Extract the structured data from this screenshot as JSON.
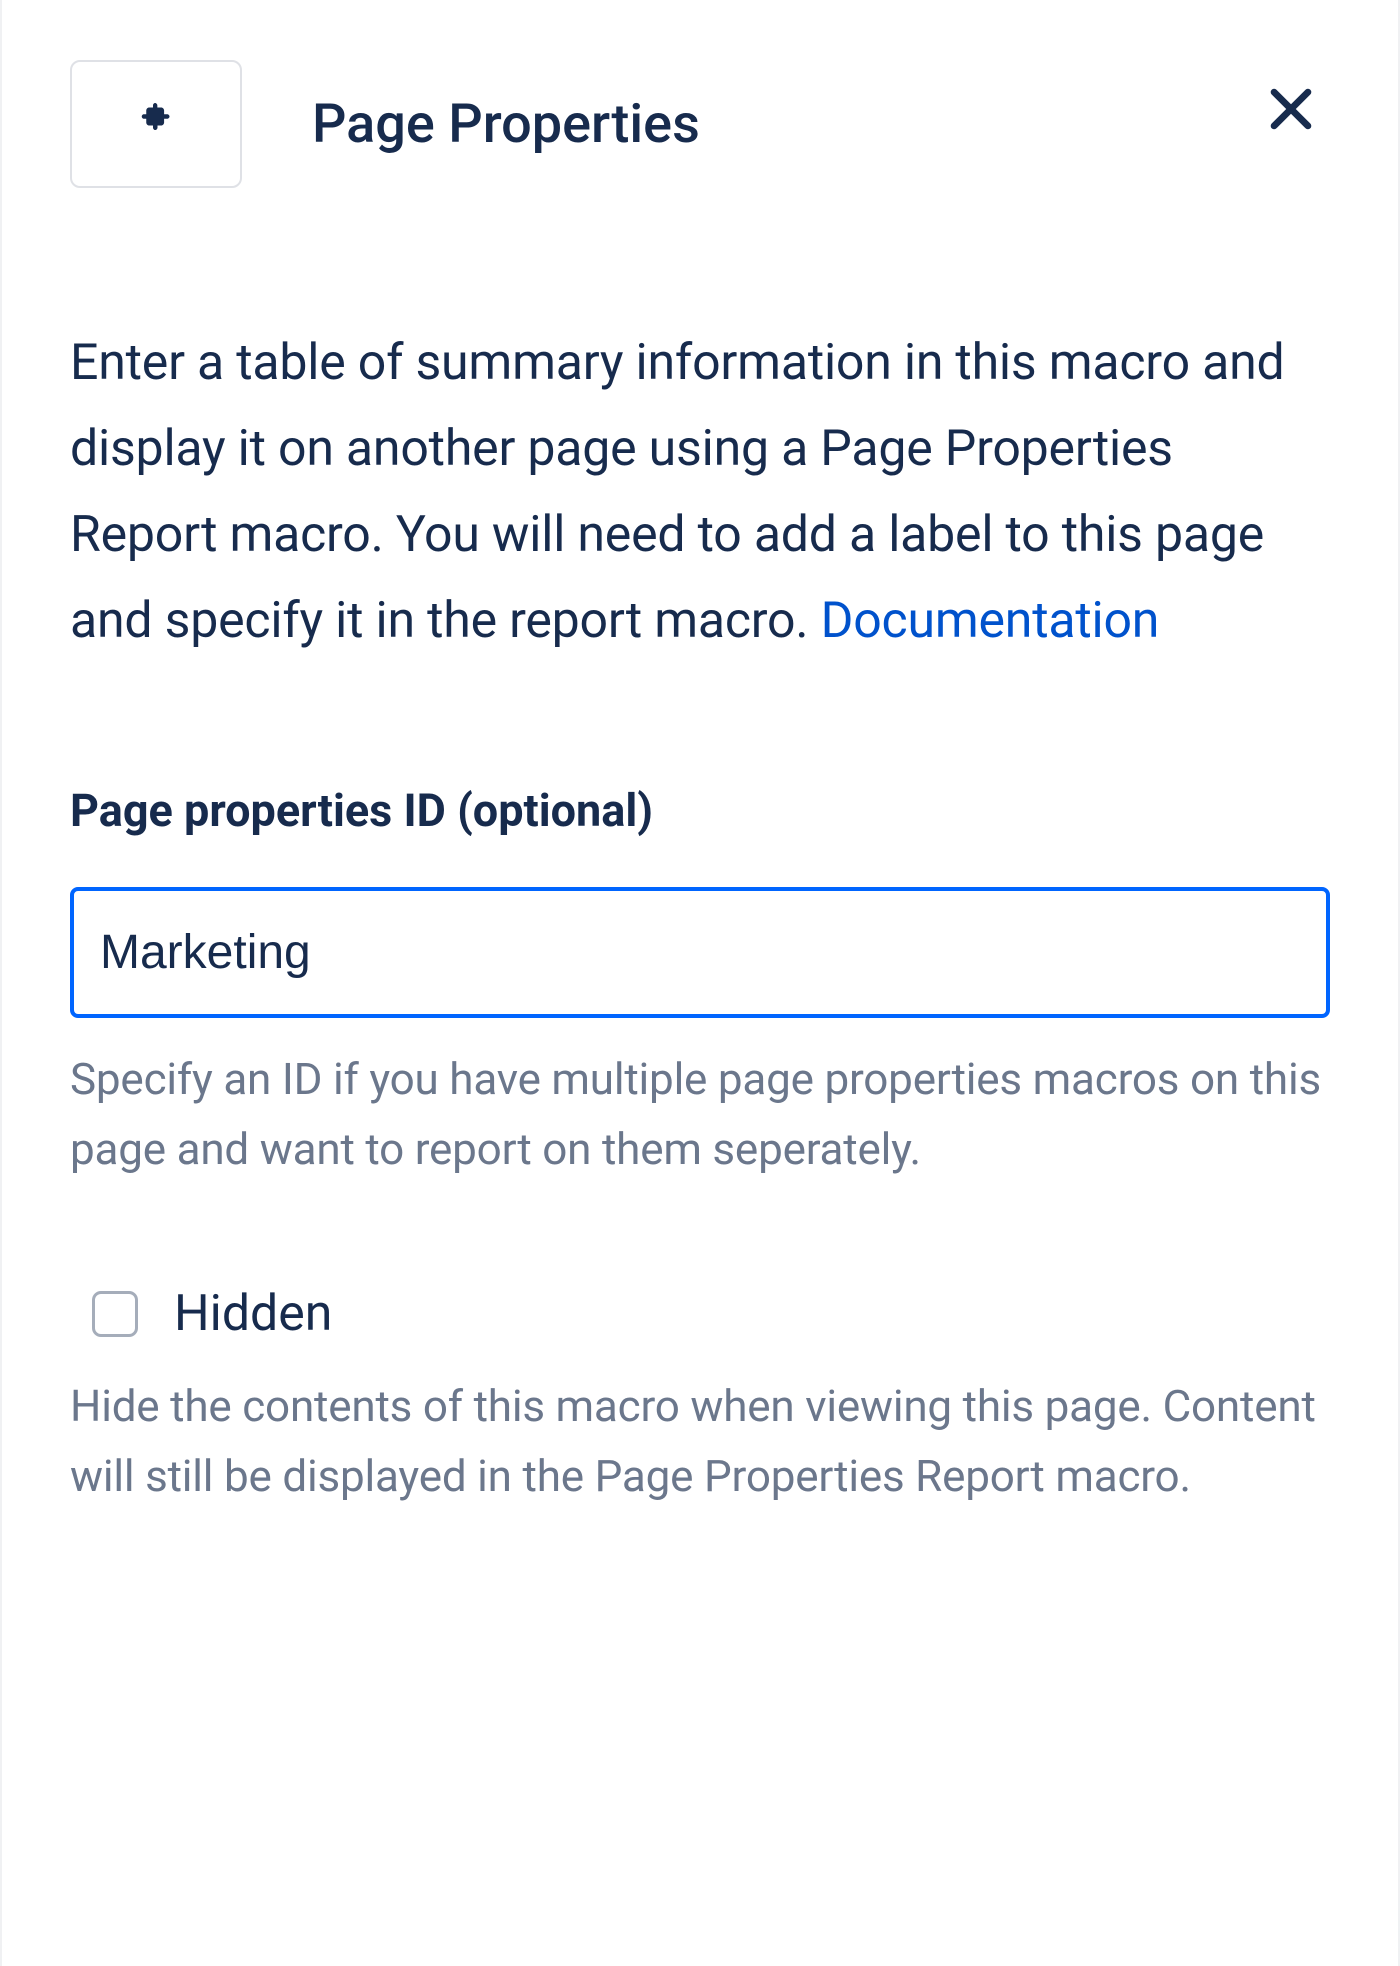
{
  "header": {
    "title": "Page Properties"
  },
  "description": {
    "text": "Enter a table of summary information in this macro and display it on another page using a Page Properties Report macro. You will need to add a label to this page and specify it in the report macro. ",
    "doc_link_label": "Documentation"
  },
  "fields": {
    "id": {
      "label": "Page properties ID (optional)",
      "value": "Marketing",
      "help": "Specify an ID if you have multiple page properties macros on this page and want to report on them seperately."
    },
    "hidden": {
      "label": "Hidden",
      "checked": false,
      "help": "Hide the contents of this macro when viewing this page. Content will still be displayed in the Page Properties Report macro."
    }
  }
}
